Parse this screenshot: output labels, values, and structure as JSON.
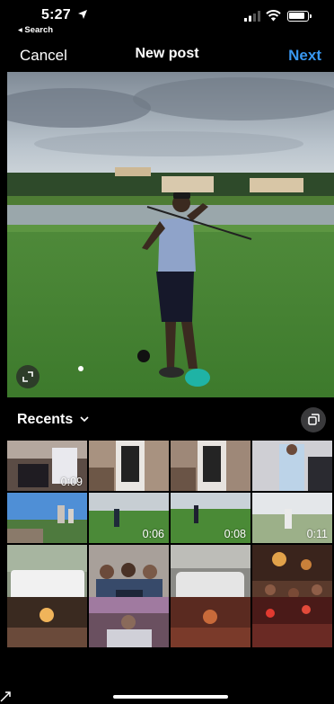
{
  "status": {
    "time": "5:27",
    "back_label": "◂ Search"
  },
  "nav": {
    "cancel": "Cancel",
    "title": "New post",
    "next": "Next"
  },
  "accent_color": "#3897f0",
  "gallery": {
    "album": "Recents",
    "items": [
      {
        "duration": "0:09"
      },
      {
        "duration": ""
      },
      {
        "duration": ""
      },
      {
        "duration": ""
      },
      {
        "duration": ""
      },
      {
        "duration": "0:06"
      },
      {
        "duration": "0:08"
      },
      {
        "duration": "0:11"
      },
      {
        "duration": ""
      },
      {
        "duration": ""
      },
      {
        "duration": ""
      },
      {
        "duration": ""
      },
      {
        "duration": ""
      },
      {
        "duration": ""
      },
      {
        "duration": ""
      },
      {
        "duration": ""
      }
    ]
  },
  "icons": [
    "location-arrow-icon",
    "signal-icon",
    "wifi-icon",
    "battery-icon",
    "expand-icon",
    "chevron-down-icon",
    "multi-select-icon"
  ]
}
